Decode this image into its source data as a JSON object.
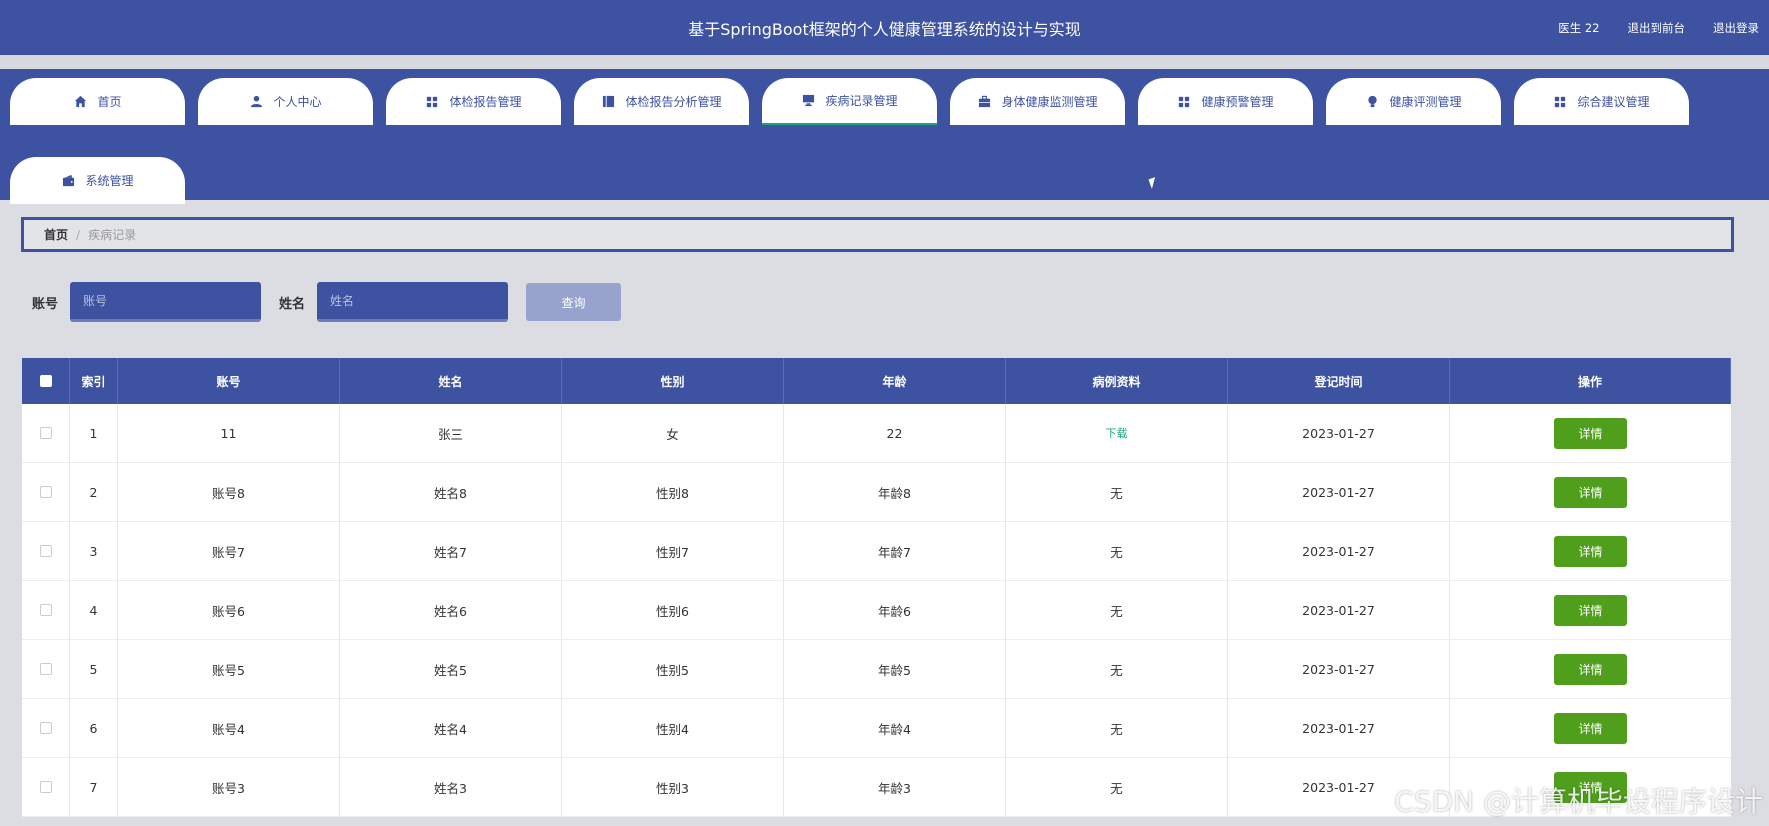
{
  "header": {
    "title": "基于SpringBoot框架的个人健康管理系统的设计与实现",
    "user": "医生 22",
    "front_link": "退出到前台",
    "logout": "退出登录"
  },
  "nav": {
    "tabs": [
      {
        "label": "首页",
        "icon": "home-icon"
      },
      {
        "label": "个人中心",
        "icon": "user-icon"
      },
      {
        "label": "体检报告管理",
        "icon": "grid-icon"
      },
      {
        "label": "体检报告分析管理",
        "icon": "book-icon"
      },
      {
        "label": "疾病记录管理",
        "icon": "monitor-icon",
        "active": true
      },
      {
        "label": "身体健康监测管理",
        "icon": "briefcase-icon"
      },
      {
        "label": "健康预警管理",
        "icon": "grid-icon"
      },
      {
        "label": "健康评测管理",
        "icon": "bulb-icon"
      },
      {
        "label": "综合建议管理",
        "icon": "grid-icon"
      },
      {
        "label": "系统管理",
        "icon": "wallet-icon"
      }
    ]
  },
  "breadcrumb": {
    "home": "首页",
    "separator": "/",
    "current": "疾病记录"
  },
  "search": {
    "account_label": "账号",
    "account_placeholder": "账号",
    "name_label": "姓名",
    "name_placeholder": "姓名",
    "query_button": "查询"
  },
  "table": {
    "headers": [
      "索引",
      "账号",
      "姓名",
      "性别",
      "年龄",
      "病例资料",
      "登记时间",
      "操作"
    ],
    "detail_label": "详情",
    "rows": [
      {
        "index": "1",
        "account": "11",
        "name": "张三",
        "gender": "女",
        "age": "22",
        "file": "下载",
        "file_link": true,
        "date": "2023-01-27"
      },
      {
        "index": "2",
        "account": "账号8",
        "name": "姓名8",
        "gender": "性别8",
        "age": "年龄8",
        "file": "无",
        "file_link": false,
        "date": "2023-01-27"
      },
      {
        "index": "3",
        "account": "账号7",
        "name": "姓名7",
        "gender": "性别7",
        "age": "年龄7",
        "file": "无",
        "file_link": false,
        "date": "2023-01-27"
      },
      {
        "index": "4",
        "account": "账号6",
        "name": "姓名6",
        "gender": "性别6",
        "age": "年龄6",
        "file": "无",
        "file_link": false,
        "date": "2023-01-27"
      },
      {
        "index": "5",
        "account": "账号5",
        "name": "姓名5",
        "gender": "性别5",
        "age": "年龄5",
        "file": "无",
        "file_link": false,
        "date": "2023-01-27"
      },
      {
        "index": "6",
        "account": "账号4",
        "name": "姓名4",
        "gender": "性别4",
        "age": "年龄4",
        "file": "无",
        "file_link": false,
        "date": "2023-01-27"
      },
      {
        "index": "7",
        "account": "账号3",
        "name": "姓名3",
        "gender": "性别3",
        "age": "年龄3",
        "file": "无",
        "file_link": false,
        "date": "2023-01-27"
      }
    ]
  },
  "watermark": "CSDN @计算机毕设程序设计",
  "colors": {
    "primary": "#3d52a0",
    "success": "#4f9e1c",
    "link": "#1ba784"
  }
}
